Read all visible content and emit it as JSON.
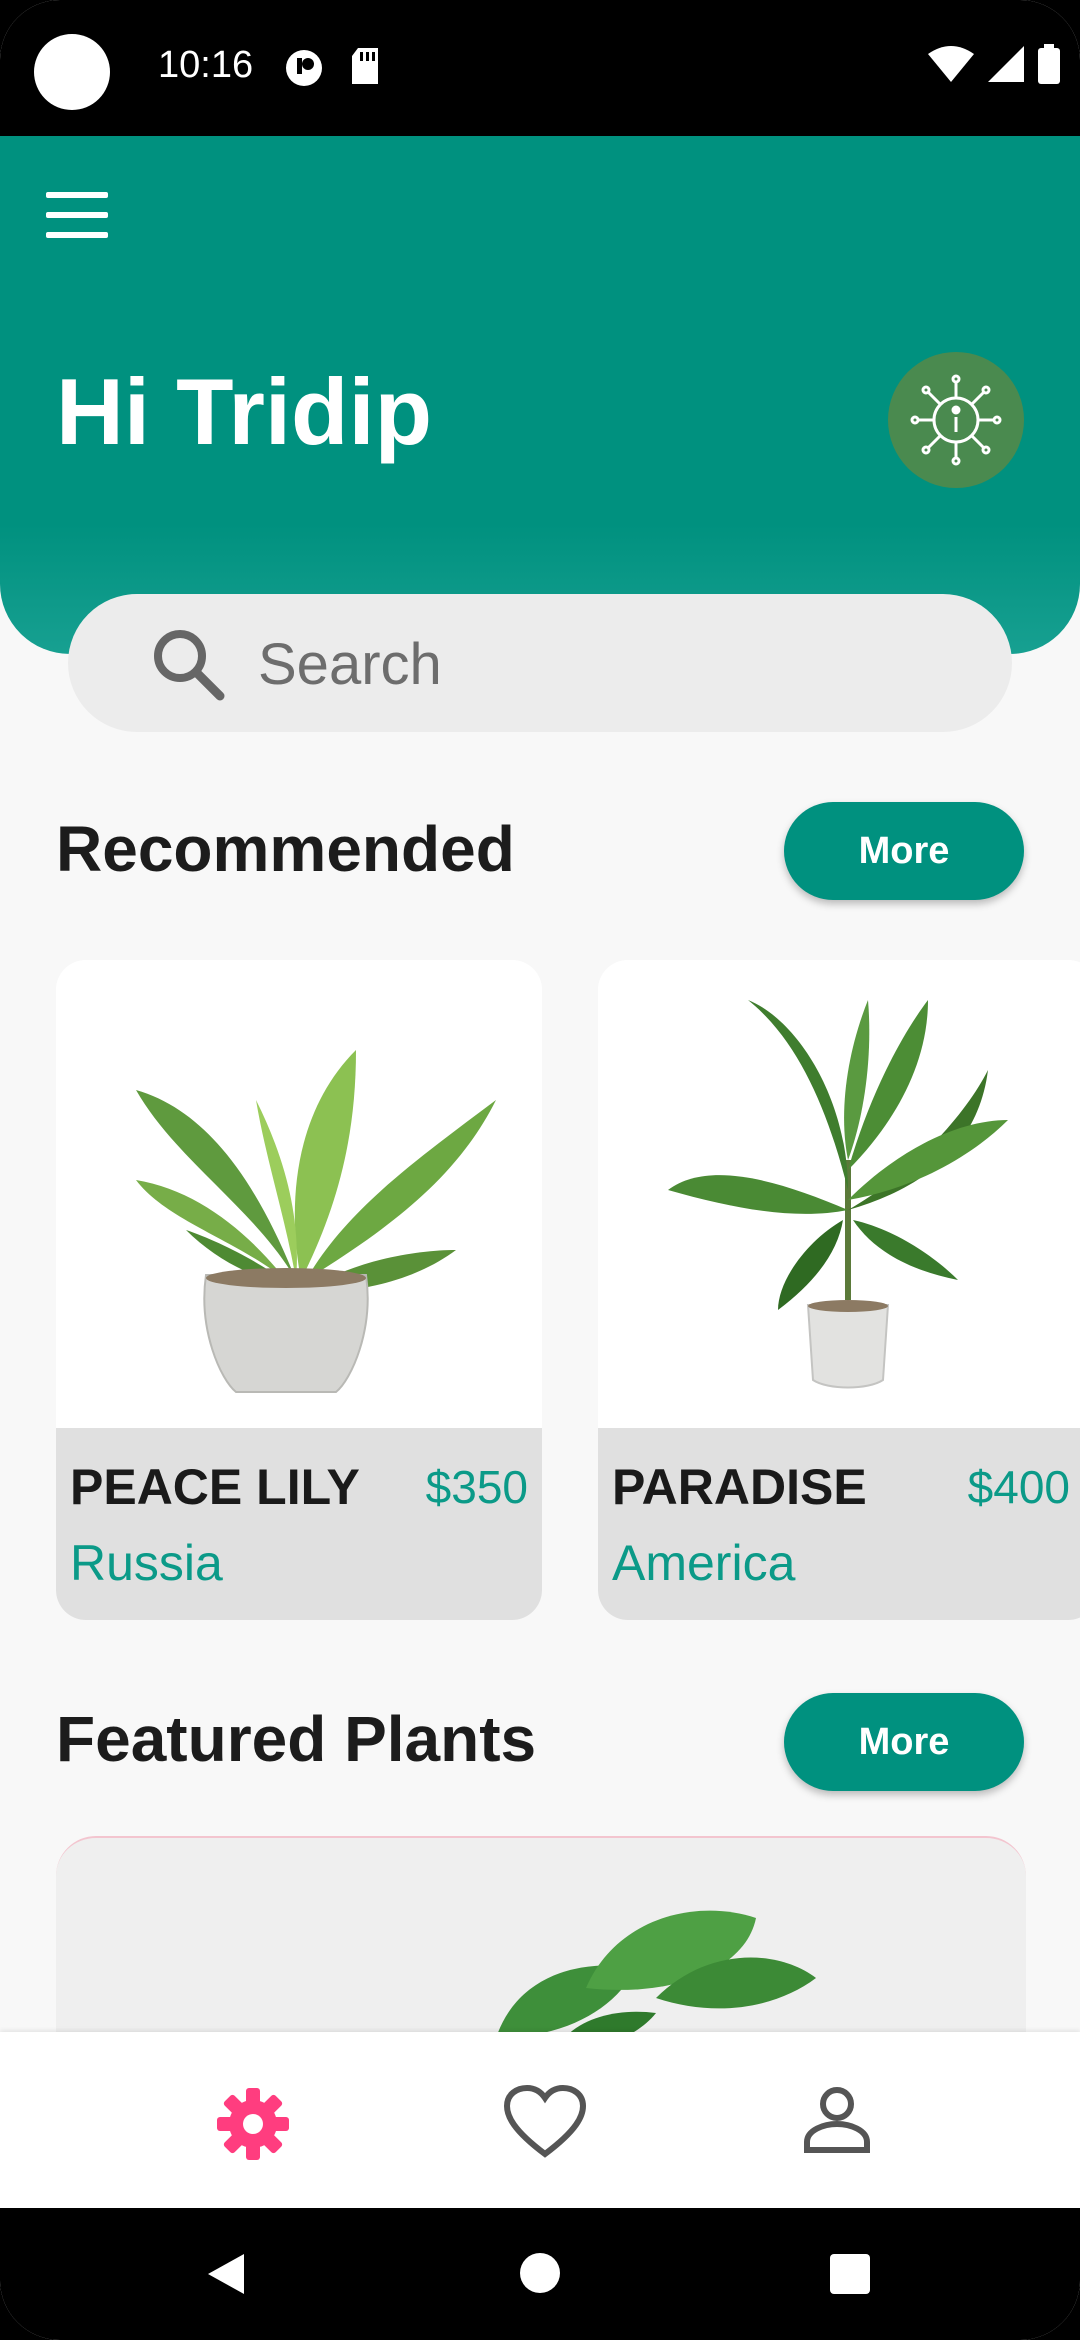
{
  "status_bar": {
    "time": "10:16"
  },
  "header": {
    "greeting": "Hi Tridip"
  },
  "search": {
    "placeholder": "Search"
  },
  "recommended": {
    "title": "Recommended",
    "more_label": "More",
    "items": [
      {
        "name": "PEACE LILY",
        "price": "$350",
        "origin": "Russia"
      },
      {
        "name": "PARADISE",
        "price": "$400",
        "origin": "America"
      }
    ]
  },
  "featured": {
    "title": "Featured Plants",
    "more_label": "More"
  },
  "bottom_nav": {
    "items": [
      {
        "icon": "gear-icon",
        "active": true
      },
      {
        "icon": "heart-icon",
        "active": false
      },
      {
        "icon": "person-icon",
        "active": false
      }
    ]
  },
  "colors": {
    "accent": "#00917f",
    "active_nav": "#ff3d7f",
    "price_text": "#0b9a88"
  }
}
